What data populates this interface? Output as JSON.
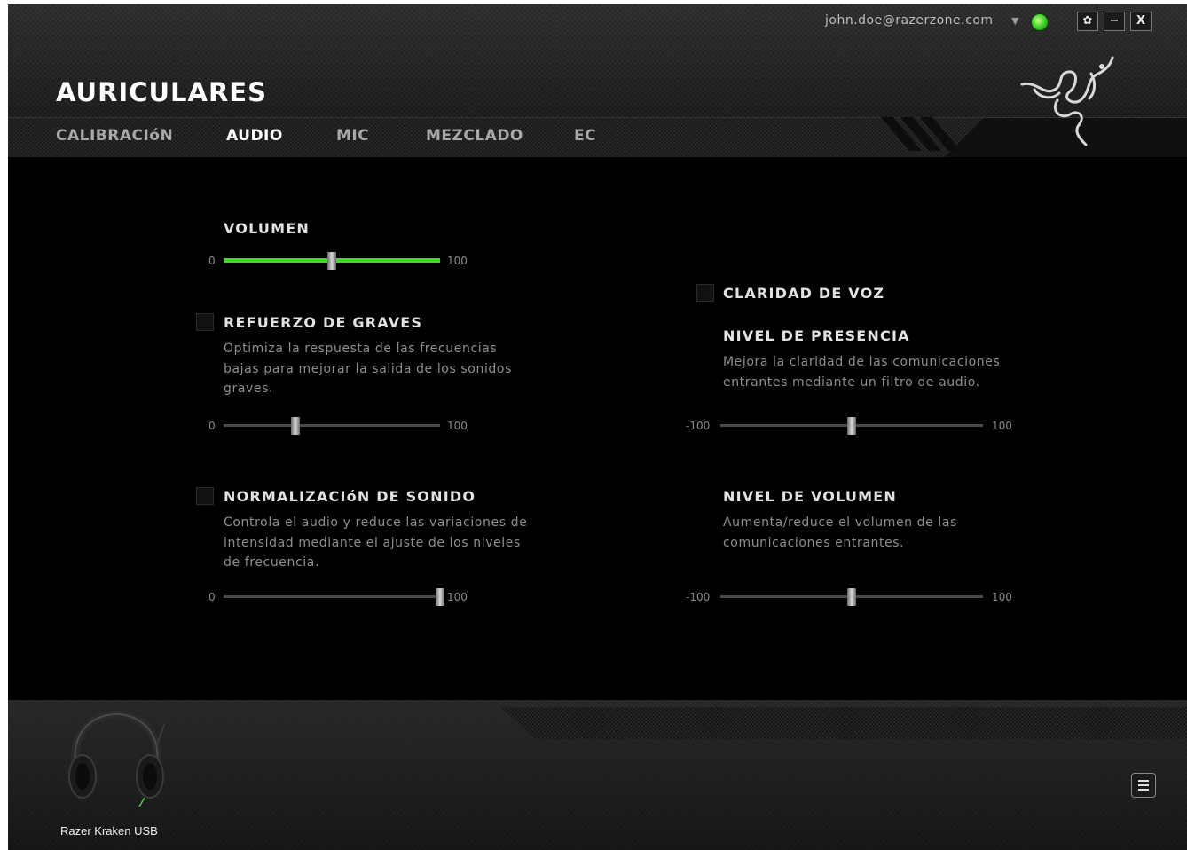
{
  "header": {
    "title": "AURICULARES",
    "account_email": "john.doe@razerzone.com",
    "account_caret_icon": "caret-down-icon",
    "status_icon": "online-status-icon",
    "window_buttons": {
      "settings": "✿",
      "minimize": "−",
      "close": "X"
    },
    "brand_colors": {
      "accent": "#44d62c",
      "background": "#000000"
    }
  },
  "tabs": [
    {
      "label": "CALIBRACIóN",
      "active": false
    },
    {
      "label": "AUDIO",
      "active": true
    },
    {
      "label": "MIC",
      "active": false
    },
    {
      "label": "MEZCLADO",
      "active": false
    },
    {
      "label": "EC",
      "active": false
    }
  ],
  "audio": {
    "volume": {
      "title": "VOLUMEN",
      "min": "0",
      "max": "100",
      "value": 50
    },
    "bass_boost": {
      "title": "REFUERZO DE GRAVES",
      "checked": false,
      "desc_lines": [
        "Optimiza la respuesta de las frecuencias",
        "bajas para mejorar la salida de los sonidos",
        "graves."
      ],
      "min": "0",
      "max": "100",
      "value": 33
    },
    "sound_normalization": {
      "title": "NORMALIZACIóN DE SONIDO",
      "checked": false,
      "desc_lines": [
        "Controla el audio y reduce las variaciones de",
        "intensidad mediante el ajuste de los niveles",
        "de frecuencia."
      ],
      "min": "0",
      "max": "100",
      "value": 100
    },
    "voice_clarity": {
      "title": "CLARIDAD DE VOZ",
      "checked": false
    },
    "presence_level": {
      "title": "NIVEL DE PRESENCIA",
      "desc_lines": [
        "Mejora la claridad de las comunicaciones",
        "entrantes mediante un filtro de audio."
      ],
      "min": "-100",
      "max": "100",
      "value": 0
    },
    "volume_level": {
      "title": "NIVEL DE VOLUMEN",
      "desc_lines": [
        "Aumenta/reduce el volumen de las",
        "comunicaciones entrantes."
      ],
      "min": "-100",
      "max": "100",
      "value": 0
    }
  },
  "footer": {
    "device_name": "Razer Kraken USB",
    "device_icon": "headset-icon",
    "menu_icon": "menu-icon"
  }
}
